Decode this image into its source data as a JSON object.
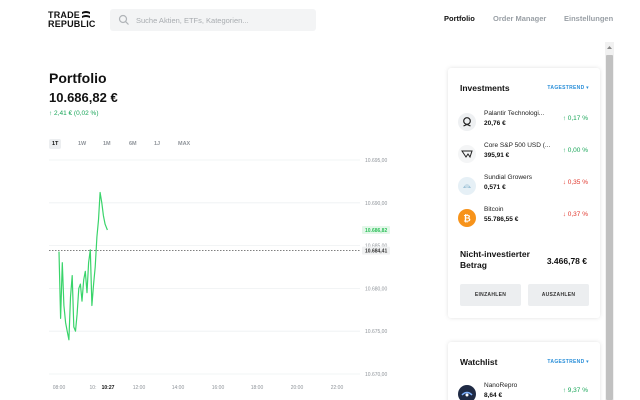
{
  "header": {
    "logo_line1": "TRADE",
    "logo_line2": "REPUBLIC",
    "search_placeholder": "Suche Aktien, ETFs, Kategorien...",
    "nav": [
      {
        "label": "Portfolio",
        "active": true
      },
      {
        "label": "Order Manager",
        "active": false
      },
      {
        "label": "Einstellungen",
        "active": false
      }
    ]
  },
  "portfolio": {
    "title": "Portfolio",
    "total": "10.686,82 €",
    "change": "↑ 2,41 € (0,02 %)",
    "ranges": [
      "1T",
      "1W",
      "1M",
      "6M",
      "1J",
      "MAX"
    ],
    "active_range": "1T"
  },
  "chart_data": {
    "type": "line",
    "title": "",
    "xlabel": "",
    "ylabel": "",
    "x_ticks": [
      "08:00",
      "10:",
      "10:27",
      "12:00",
      "14:00",
      "16:00",
      "18:00",
      "20:00",
      "22:00"
    ],
    "y_ticks": [
      "10.695,00",
      "10.690,00",
      "10.685,00",
      "10.680,00",
      "10.675,00",
      "10.670,00"
    ],
    "ylim": [
      10670,
      10695
    ],
    "current_label": "10.686,82",
    "reference_label": "10.684,41",
    "reference_value": 10684.41,
    "grid": "horizontal",
    "colors": {
      "line": "#39d46a",
      "current_badge": "#2ec05a",
      "reference": "#555555"
    },
    "series": [
      {
        "x": [
          "08:00",
          "08:05",
          "08:10",
          "08:15",
          "08:20",
          "08:25",
          "08:30",
          "08:35",
          "08:40",
          "08:45",
          "08:50",
          "08:55",
          "09:00",
          "09:05",
          "09:10",
          "09:15",
          "09:20",
          "09:25",
          "09:30",
          "09:35",
          "09:40",
          "09:45",
          "09:50",
          "09:55",
          "10:00",
          "10:05",
          "10:10",
          "10:15",
          "10:20",
          "10:27"
        ],
        "values": [
          10684.3,
          10676.5,
          10683.0,
          10678.0,
          10676.0,
          10675.0,
          10674.0,
          10679.0,
          10681.5,
          10675.5,
          10675.0,
          10677.0,
          10680.0,
          10680.5,
          10678.5,
          10681.0,
          10682.0,
          10679.5,
          10683.0,
          10684.5,
          10678.0,
          10680.5,
          10682.5,
          10686.0,
          10688.0,
          10691.2,
          10690.0,
          10688.5,
          10687.5,
          10686.82
        ]
      }
    ]
  },
  "investments": {
    "title": "Investments",
    "trend_label": "TAGESTREND ▾",
    "items": [
      {
        "name": "Palantir Technologi...",
        "value": "20,76 €",
        "perf": "↑ 0,17 %",
        "dir": "pos",
        "icon": "palantir-icon"
      },
      {
        "name": "Core S&P 500 USD (...",
        "value": "395,91 €",
        "perf": "↑ 0,00 %",
        "dir": "pos",
        "icon": "etf-icon"
      },
      {
        "name": "Sundial Growers",
        "value": "0,571 €",
        "perf": "↓ 0,35 %",
        "dir": "neg",
        "icon": "sundial-icon"
      },
      {
        "name": "Bitcoin",
        "value": "55.786,55 €",
        "perf": "↓ 0,37 %",
        "dir": "neg",
        "icon": "bitcoin-icon"
      }
    ],
    "uninvested_label": "Nicht-investierter Betrag",
    "uninvested_value": "3.466,78 €",
    "deposit_label": "EINZAHLEN",
    "withdraw_label": "AUSZAHLEN"
  },
  "watchlist": {
    "title": "Watchlist",
    "trend_label": "TAGESTREND ▾",
    "items": [
      {
        "name": "NanoRepro",
        "value": "8,64 €",
        "perf": "↑ 9,37 %",
        "dir": "pos",
        "icon": "nanorepro-icon"
      }
    ]
  }
}
